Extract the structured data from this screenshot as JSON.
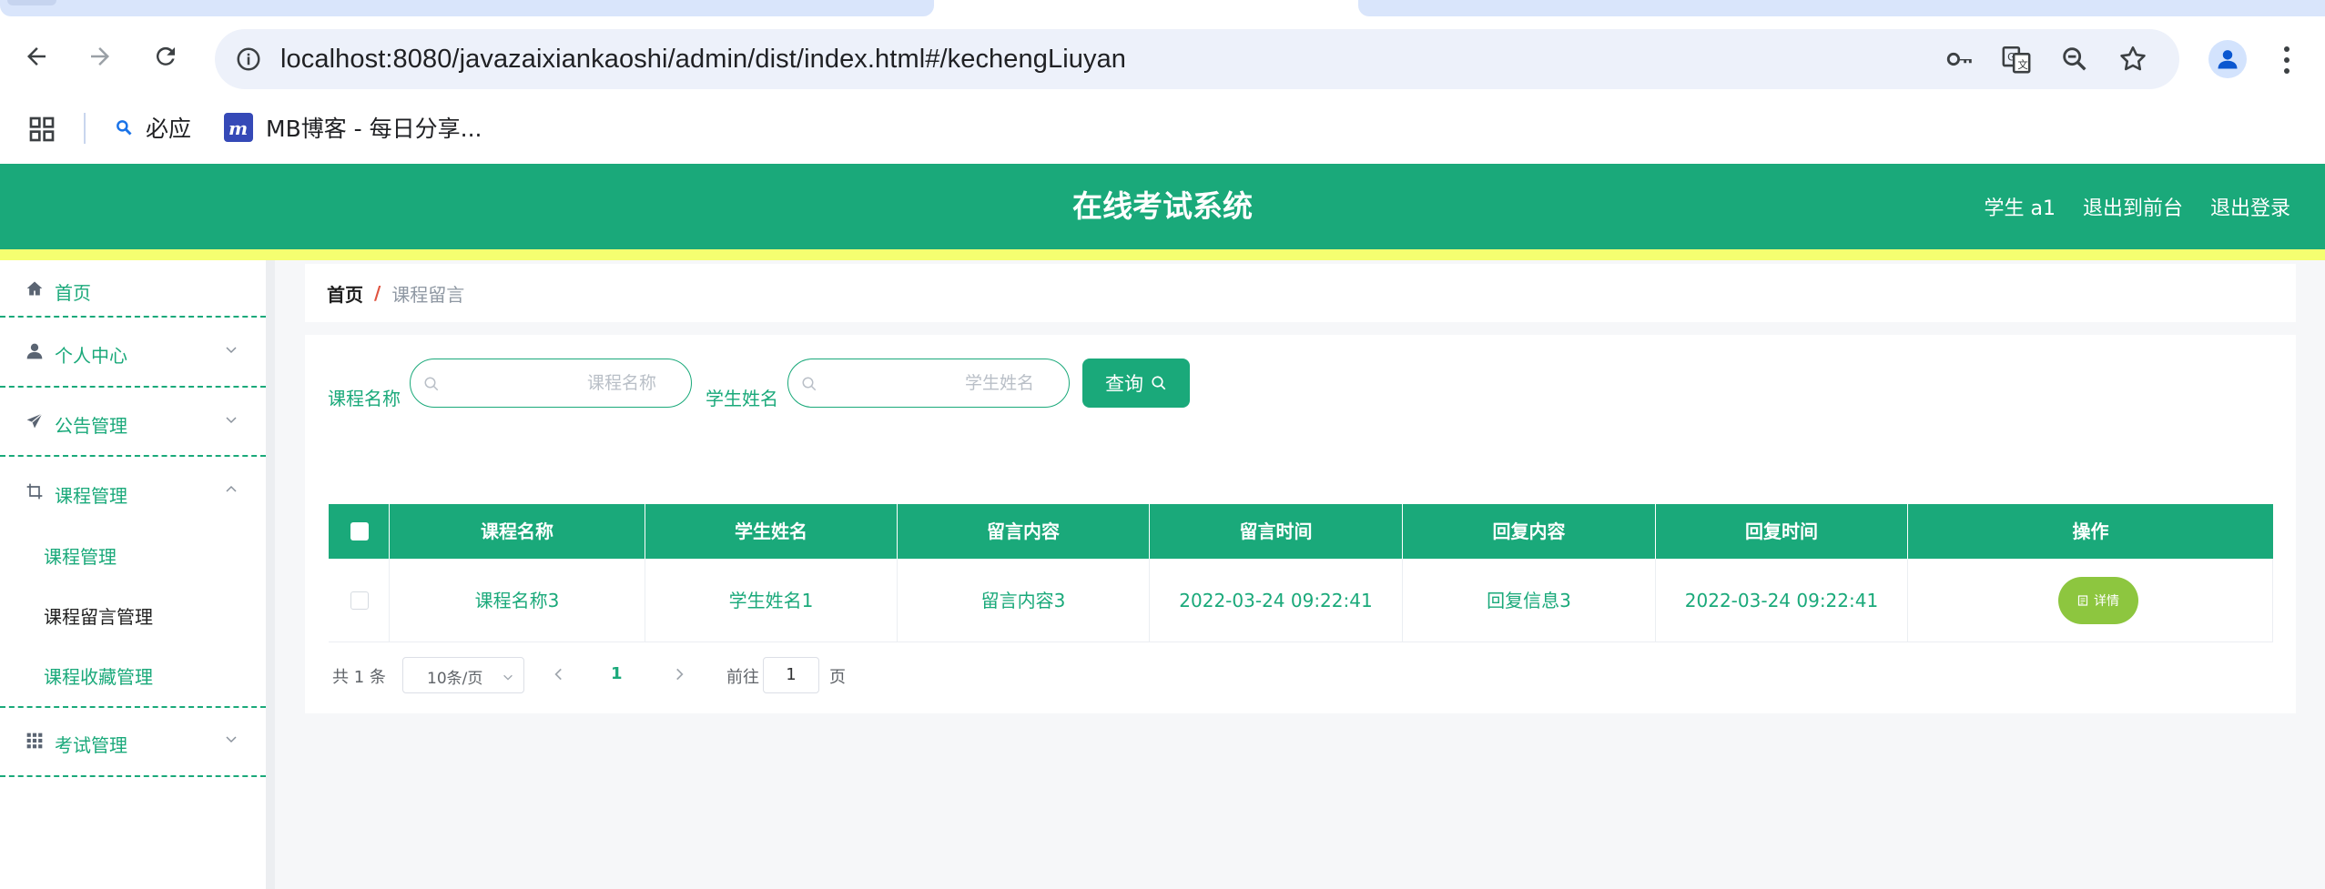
{
  "browser": {
    "url": "localhost:8080/javazaixiankaoshi/admin/dist/index.html#/kechengLiuyan",
    "bookmarks": [
      {
        "label": "必应",
        "icon": "search-icon"
      },
      {
        "label": "MB博客 - 每日分享...",
        "icon": "mb-logo-icon"
      }
    ]
  },
  "header": {
    "title": "在线考试系统",
    "user": "学生 a1",
    "to_front": "退出到前台",
    "logout": "退出登录"
  },
  "colors": {
    "primary": "#1aa97a",
    "accent_bar": "#f5ff70",
    "detail_button": "#8dc63f"
  },
  "sidebar": {
    "items": [
      {
        "label": "首页",
        "icon": "home-icon"
      },
      {
        "label": "个人中心",
        "icon": "user-icon"
      },
      {
        "label": "公告管理",
        "icon": "paper-plane-icon"
      },
      {
        "label": "课程管理",
        "icon": "crop-icon"
      },
      {
        "label": "考试管理",
        "icon": "grid-icon"
      }
    ],
    "sub_items": [
      {
        "label": "课程管理"
      },
      {
        "label": "课程留言管理"
      },
      {
        "label": "课程收藏管理"
      }
    ]
  },
  "breadcrumb": {
    "home": "首页",
    "separator": "/",
    "current": "课程留言"
  },
  "search": {
    "course_label": "课程名称",
    "course_placeholder": "课程名称",
    "student_label": "学生姓名",
    "student_placeholder": "学生姓名",
    "query_button": "查询"
  },
  "table": {
    "columns": [
      "课程名称",
      "学生姓名",
      "留言内容",
      "留言时间",
      "回复内容",
      "回复时间",
      "操作"
    ],
    "rows": [
      {
        "course": "课程名称3",
        "student": "学生姓名1",
        "message": "留言内容3",
        "message_time": "2022-03-24 09:22:41",
        "reply": "回复信息3",
        "reply_time": "2022-03-24 09:22:41",
        "action": "详情"
      }
    ]
  },
  "pagination": {
    "total": "共 1 条",
    "page_size": "10条/页",
    "current_page": "1",
    "goto_label": "前往",
    "goto_value": "1",
    "page_suffix": "页"
  }
}
